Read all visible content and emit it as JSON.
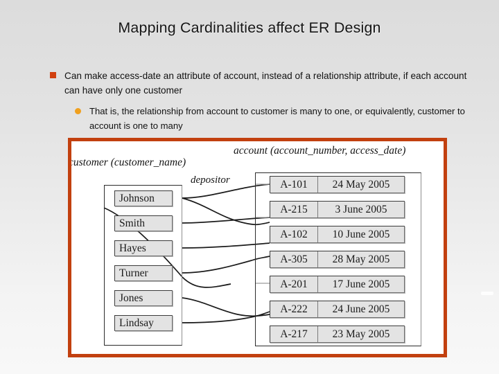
{
  "slide": {
    "title": "Mapping Cardinalities affect ER Design",
    "bullets": [
      {
        "level": 1,
        "marker": "square-bullet",
        "marker_color": "#d1400f",
        "text": "Can make access-date an attribute of account, instead of a relationship attribute, if each account can have only one customer"
      },
      {
        "level": 2,
        "marker": "round-bullet",
        "marker_color": "#f0a01e",
        "text": "That is, the relationship from account to customer is many to one, or equivalently, customer to account is one to many"
      }
    ]
  },
  "figure": {
    "border_color": "#c2400f",
    "background": "#ffffff",
    "labels": {
      "customer_entity": "customer (customer_name)",
      "account_entity": "account (account_number, access_date)",
      "relationship": "depositor"
    },
    "customer_values": [
      "Johnson",
      "Smith",
      "Hayes",
      "Turner",
      "Jones",
      "Lindsay"
    ],
    "account_rows": [
      {
        "number": "A-101",
        "access_date": "24 May 2005"
      },
      {
        "number": "A-215",
        "access_date": "3 June 2005"
      },
      {
        "number": "A-102",
        "access_date": "10 June 2005"
      },
      {
        "number": "A-305",
        "access_date": "28 May 2005"
      },
      {
        "number": "A-201",
        "access_date": "17 June 2005"
      },
      {
        "number": "A-222",
        "access_date": "24 June 2005"
      },
      {
        "number": "A-217",
        "access_date": "23 May 2005"
      }
    ]
  }
}
